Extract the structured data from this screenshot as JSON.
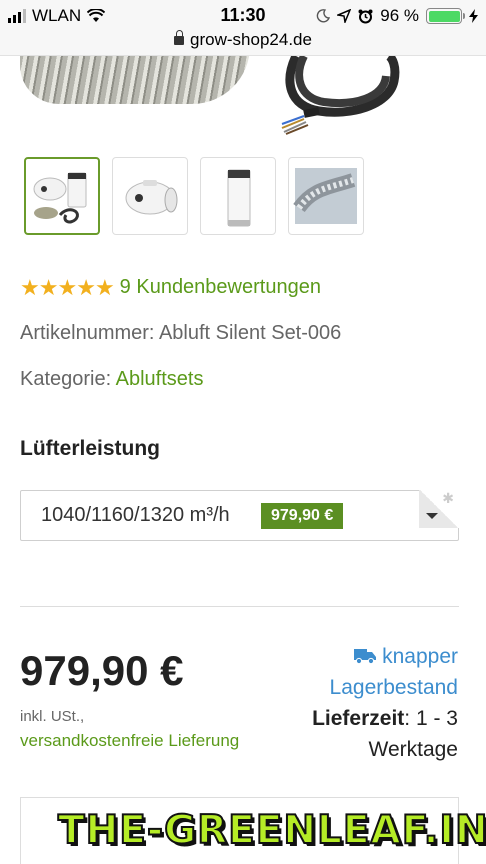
{
  "status_bar": {
    "carrier": "WLAN",
    "time": "11:30",
    "battery_percent": "96 %"
  },
  "browser": {
    "url": "grow-shop24.de"
  },
  "product": {
    "rating_stars": 5,
    "reviews_link": "9 Kundenbewertungen",
    "sku_label": "Artikelnummer:",
    "sku_value": "Abluft Silent Set-006",
    "category_label": "Kategorie:",
    "category_value": "Abluftsets",
    "option_label": "Lüfterleistung",
    "option_selected": "1040/1160/1320 m³/h",
    "option_price_badge": "979,90 €",
    "price": "979,90 €",
    "tax_note": "inkl. USt.,",
    "shipping_note": "versandkostenfreie Lieferung",
    "stock_line1": "knapper",
    "stock_line2": "Lagerbestand",
    "delivery_label": "Lieferzeit",
    "delivery_value": ": 1 - 3",
    "delivery_unit": "Werktage"
  },
  "watermark": "THE-GREENLEAF.IN",
  "colors": {
    "accent_green": "#5b9a1a",
    "badge_green": "#5b8f22",
    "link_blue": "#3c8dce",
    "star": "#f2b01e"
  },
  "icons": {
    "wifi": "wifi-icon",
    "lock": "lock-icon",
    "truck": "truck-icon",
    "caret": "caret-down-icon"
  }
}
